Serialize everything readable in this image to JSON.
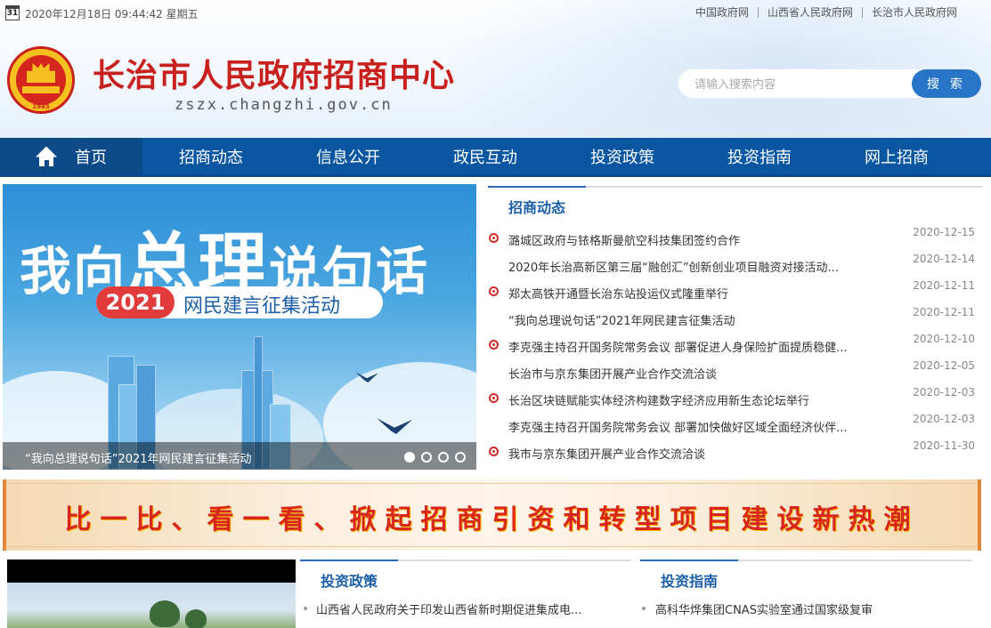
{
  "topbar": {
    "date": "2020年12月18日 09:44:42 星期五",
    "calendar_day": "31",
    "links": [
      "中国政府网",
      "山西省人民政府网",
      "长治市人民政府网"
    ]
  },
  "brand": {
    "title": "长治市人民政府招商中心",
    "url": "zszx.changzhi.gov.cn",
    "emblem_text": "中国长治",
    "emblem_year": "1945"
  },
  "search": {
    "placeholder": "请输入搜索内容",
    "button": "搜 索"
  },
  "nav": {
    "items": [
      "首页",
      "招商动态",
      "信息公开",
      "政民互动",
      "投资政策",
      "投资指南",
      "网上招商"
    ],
    "active_index": 0
  },
  "slider": {
    "headline_a": "我向",
    "headline_b": "总理",
    "headline_c": "说句话",
    "year": "2021",
    "subtitle": "网民建言征集活动",
    "caption": "“我向总理说句话”2021年网民建言征集活动",
    "dot_count": 4,
    "active_dot": 0
  },
  "news": {
    "title": "招商动态",
    "items": [
      {
        "text": "潞城区政府与铱格斯曼航空科技集团签约合作",
        "date": "2020-12-15",
        "bullet": true
      },
      {
        "text": "2020年长治高新区第三届“融创汇”创新创业项目融资对接活动...",
        "date": "2020-12-14",
        "bullet": false
      },
      {
        "text": "郑太高铁开通暨长治东站投运仪式隆重举行",
        "date": "2020-12-11",
        "bullet": true
      },
      {
        "text": "“我向总理说句话”2021年网民建言征集活动",
        "date": "2020-12-11",
        "bullet": false
      },
      {
        "text": "李克强主持召开国务院常务会议 部署促进人身保险扩面提质稳健...",
        "date": "2020-12-10",
        "bullet": true
      },
      {
        "text": "长治市与京东集团开展产业合作交流洽谈",
        "date": "2020-12-05",
        "bullet": false
      },
      {
        "text": "长治区块链赋能实体经济构建数字经济应用新生态论坛举行",
        "date": "2020-12-03",
        "bullet": true
      },
      {
        "text": "李克强主持召开国务院常务会议 部署加快做好区域全面经济伙伴...",
        "date": "2020-12-03",
        "bullet": false
      },
      {
        "text": "我市与京东集团开展产业合作交流洽谈",
        "date": "2020-11-30",
        "bullet": true
      }
    ]
  },
  "slogan": "比一比、看一看、掀起招商引资和转型项目建设新热潮",
  "policy": {
    "title": "投资政策",
    "items": [
      "山西省人民政府关于印发山西省新时期促进集成电..."
    ]
  },
  "guide": {
    "title": "投资指南",
    "items": [
      "高科华烨集团CNAS实验室通过国家级复审"
    ]
  },
  "colors": {
    "brand_red": "#c8201c",
    "nav_blue": "#0a56a0",
    "accent_blue": "#2875c8",
    "slogan_red": "#d8261d"
  }
}
